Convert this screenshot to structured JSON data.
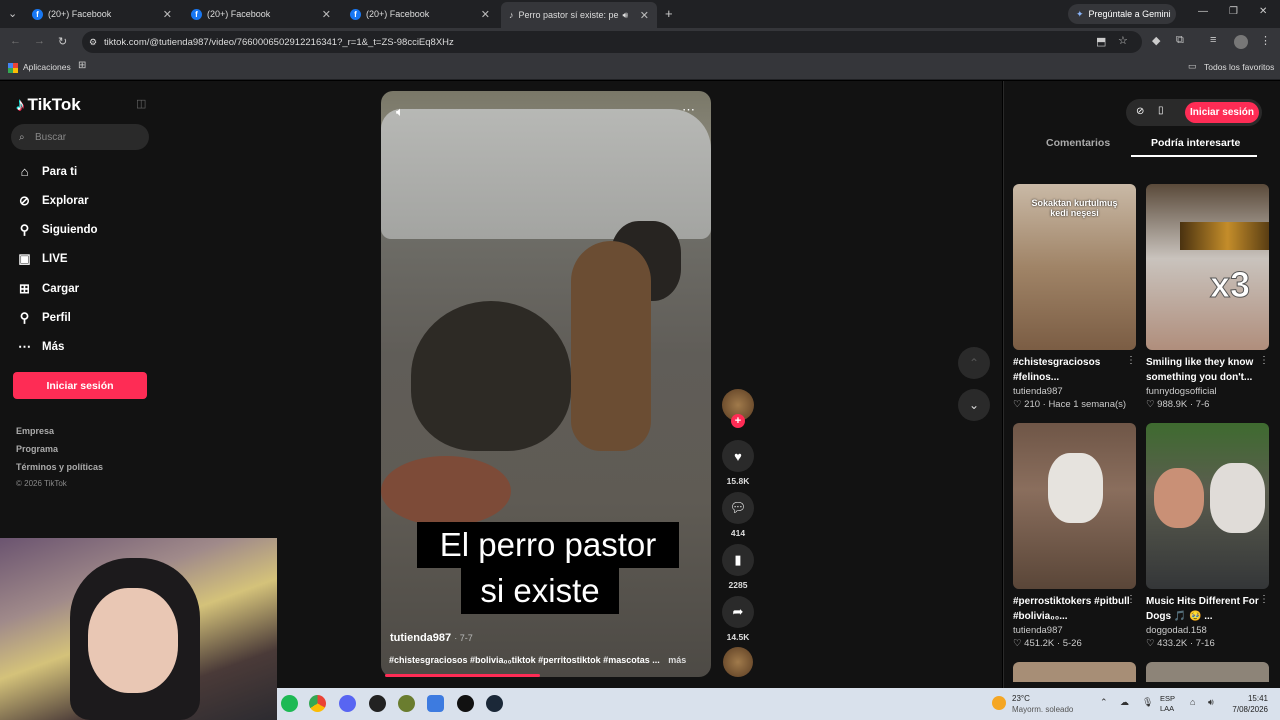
{
  "browser": {
    "tabs": [
      {
        "title": "(20+) Facebook"
      },
      {
        "title": "(20+) Facebook"
      },
      {
        "title": "(20+) Facebook"
      },
      {
        "title": "Perro pastor sí existe: perrit"
      }
    ],
    "gemini_button": "Pregúntale a Gemini",
    "url": "tiktok.com/@tutienda987/video/7660006502912216341?_r=1&_t=ZS-98cciEq8XHz",
    "bookmarks": {
      "apps": "Aplicaciones",
      "all": "Todos los favoritos"
    }
  },
  "sidebar": {
    "logo": "TikTok",
    "search_placeholder": "Buscar",
    "nav": [
      {
        "label": "Para ti",
        "icon": "home-icon"
      },
      {
        "label": "Explorar",
        "icon": "compass-icon"
      },
      {
        "label": "Siguiendo",
        "icon": "user-follow-icon"
      },
      {
        "label": "LIVE",
        "icon": "live-icon"
      },
      {
        "label": "Cargar",
        "icon": "upload-icon"
      },
      {
        "label": "Perfil",
        "icon": "profile-icon"
      },
      {
        "label": "Más",
        "icon": "more-icon"
      }
    ],
    "login": "Iniciar sesión",
    "footer": [
      "Empresa",
      "Programa",
      "Términos y políticas"
    ],
    "copyright": "© 2026 TikTok"
  },
  "video": {
    "caption_line1": "El perro pastor",
    "caption_line2": "si existe",
    "author": "tutienda987",
    "date": "7-7",
    "tags": "#chistesgraciosos #bolivia₀₀tiktok #perritostiktok #mascotas ...",
    "more": "más",
    "likes": "15.8K",
    "comments": "414",
    "saves": "2285",
    "shares": "14.5K",
    "progress": 0.48
  },
  "right_panel": {
    "login": "Iniciar sesión",
    "tabs": [
      "Comentarios",
      "Podría interesarte"
    ],
    "active_tab": "Podría interesarte",
    "cards": [
      {
        "thumb_text": "Sokaktan kurtulmuş kedi neşesi",
        "title": "#chistesgraciosos #felinos...",
        "user": "tutienda987",
        "stats": "♡ 210 · Hace 1 semana(s)"
      },
      {
        "thumb_text": "x3",
        "title": "Smiling like they know something you don't...",
        "user": "funnydogsofficial",
        "stats": "♡ 988.9K · 7-6"
      },
      {
        "thumb_text": "",
        "title": "#perrostiktokers #pitbull #bolivia₀₀...",
        "user": "tutienda987",
        "stats": "♡ 451.2K · 5-26"
      },
      {
        "thumb_text": "",
        "title": "Music Hits Different For Dogs 🎵 🥹 ...",
        "user": "doggodad.158",
        "stats": "♡ 433.2K · 7-16"
      }
    ]
  },
  "taskbar": {
    "temp": "23°C",
    "weather": "Mayorm. soleado",
    "lang1": "ESP",
    "lang2": "LAA",
    "time": "15:41",
    "date": "7/08/2026"
  },
  "colors": {
    "accent": "#fe2c55",
    "bg": "#121212"
  }
}
